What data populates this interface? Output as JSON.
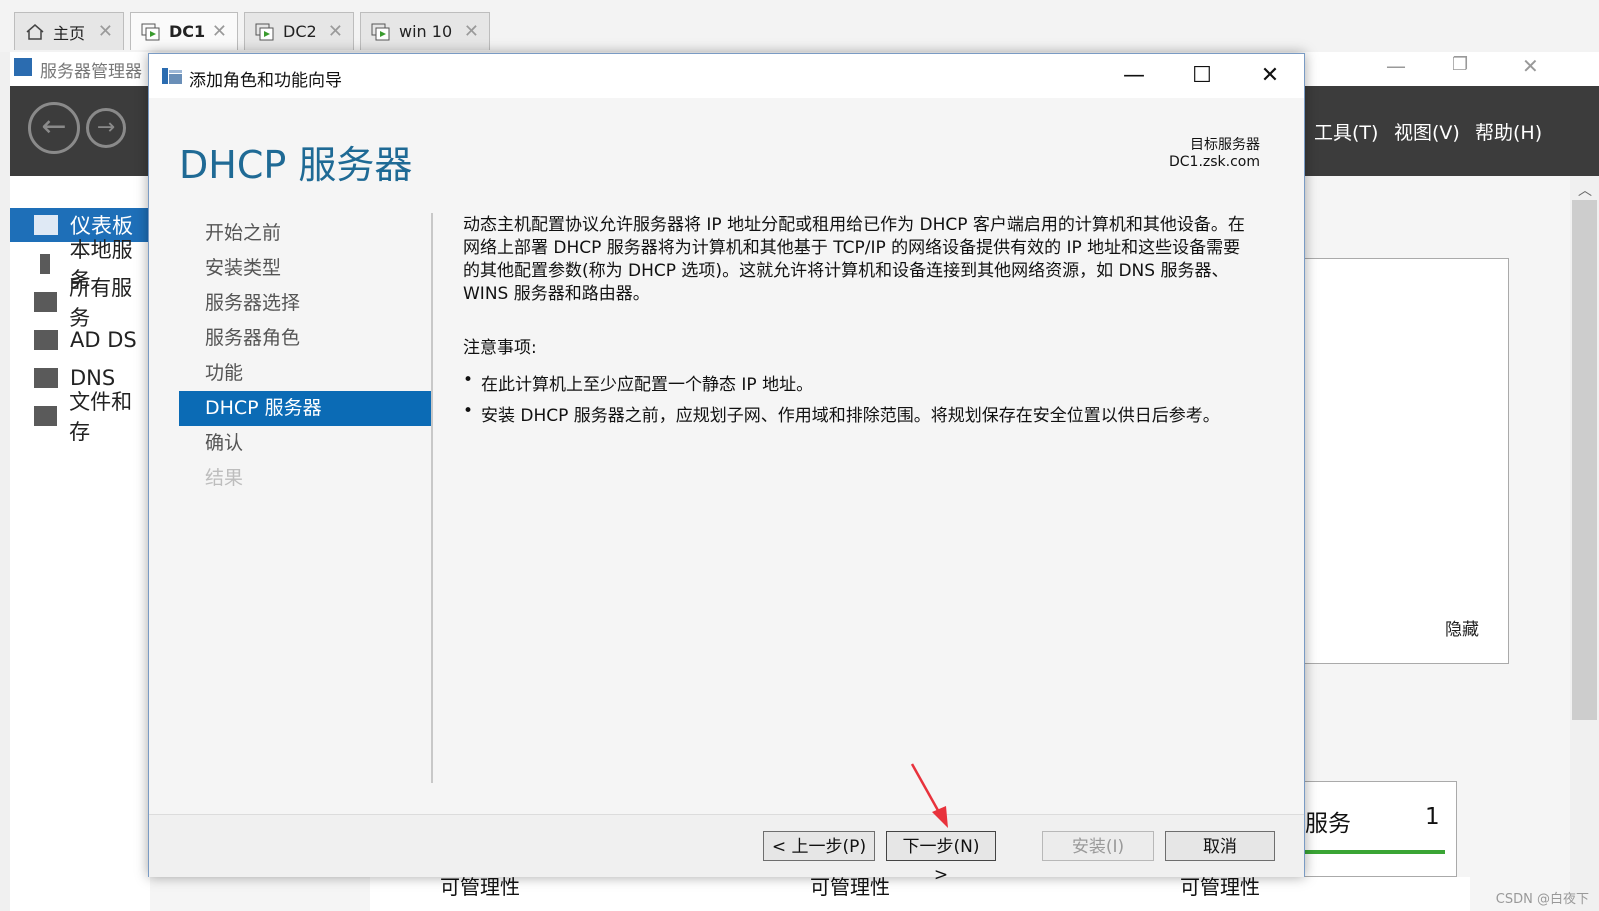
{
  "vm_tabs": [
    {
      "label": "主页",
      "icon": "home-icon",
      "active": false
    },
    {
      "label": "DC1",
      "icon": "vm-icon",
      "active": true
    },
    {
      "label": "DC2",
      "icon": "vm-icon",
      "active": false
    },
    {
      "label": "win 10",
      "icon": "vm-icon",
      "active": false
    }
  ],
  "server_manager": {
    "title": "服务器管理器",
    "menu": {
      "tools": "工具(T)",
      "view": "视图(V)",
      "help": "帮助(H)"
    },
    "sidebar": [
      {
        "label": "仪表板",
        "icon": "dashboard-icon",
        "active": true
      },
      {
        "label": "本地服务",
        "icon": "server-icon"
      },
      {
        "label": "所有服务",
        "icon": "servers-icon"
      },
      {
        "label": "AD DS",
        "icon": "ad-ds-icon"
      },
      {
        "label": "DNS",
        "icon": "dns-icon"
      },
      {
        "label": "文件和存",
        "icon": "file-storage-icon"
      }
    ],
    "hide_label": "隐藏",
    "tile_title": "服务",
    "tile_count": "1",
    "manageability": "可管理性"
  },
  "wizard": {
    "title": "添加角色和功能向导",
    "heading": "DHCP 服务器",
    "target_label": "目标服务器",
    "target_value": "DC1.zsk.com",
    "steps": [
      {
        "label": "开始之前",
        "state": "normal"
      },
      {
        "label": "安装类型",
        "state": "normal"
      },
      {
        "label": "服务器选择",
        "state": "normal"
      },
      {
        "label": "服务器角色",
        "state": "normal"
      },
      {
        "label": "功能",
        "state": "normal"
      },
      {
        "label": "DHCP 服务器",
        "state": "active"
      },
      {
        "label": "确认",
        "state": "normal"
      },
      {
        "label": "结果",
        "state": "disabled"
      }
    ],
    "description_lines": [
      "动态主机配置协议允许服务器将 IP 地址分配或租用给已作为 DHCP 客户端启用的计算机和其他设备。在",
      "网络上部署 DHCP 服务器将为计算机和其他基于 TCP/IP 的网络设备提供有效的 IP 地址和这些设备需要",
      "的其他配置参数(称为 DHCP 选项)。这就允许将计算机和设备连接到其他网络资源，如 DNS 服务器、",
      "WINS 服务器和路由器。"
    ],
    "notes_title": "注意事项:",
    "notes": [
      "在此计算机上至少应配置一个静态 IP 地址。",
      "安装 DHCP 服务器之前，应规划子网、作用域和排除范围。将规划保存在安全位置以供日后参考。"
    ],
    "buttons": {
      "prev": "< 上一步(P)",
      "next": "下一步(N) >",
      "install": "安装(I)",
      "cancel": "取消"
    }
  },
  "watermark": "CSDN @白夜下",
  "colors": {
    "accent": "#0b6bb5",
    "heading": "#1f6a95",
    "toolbar": "#3c3c3c",
    "arrow": "#e8323c"
  }
}
